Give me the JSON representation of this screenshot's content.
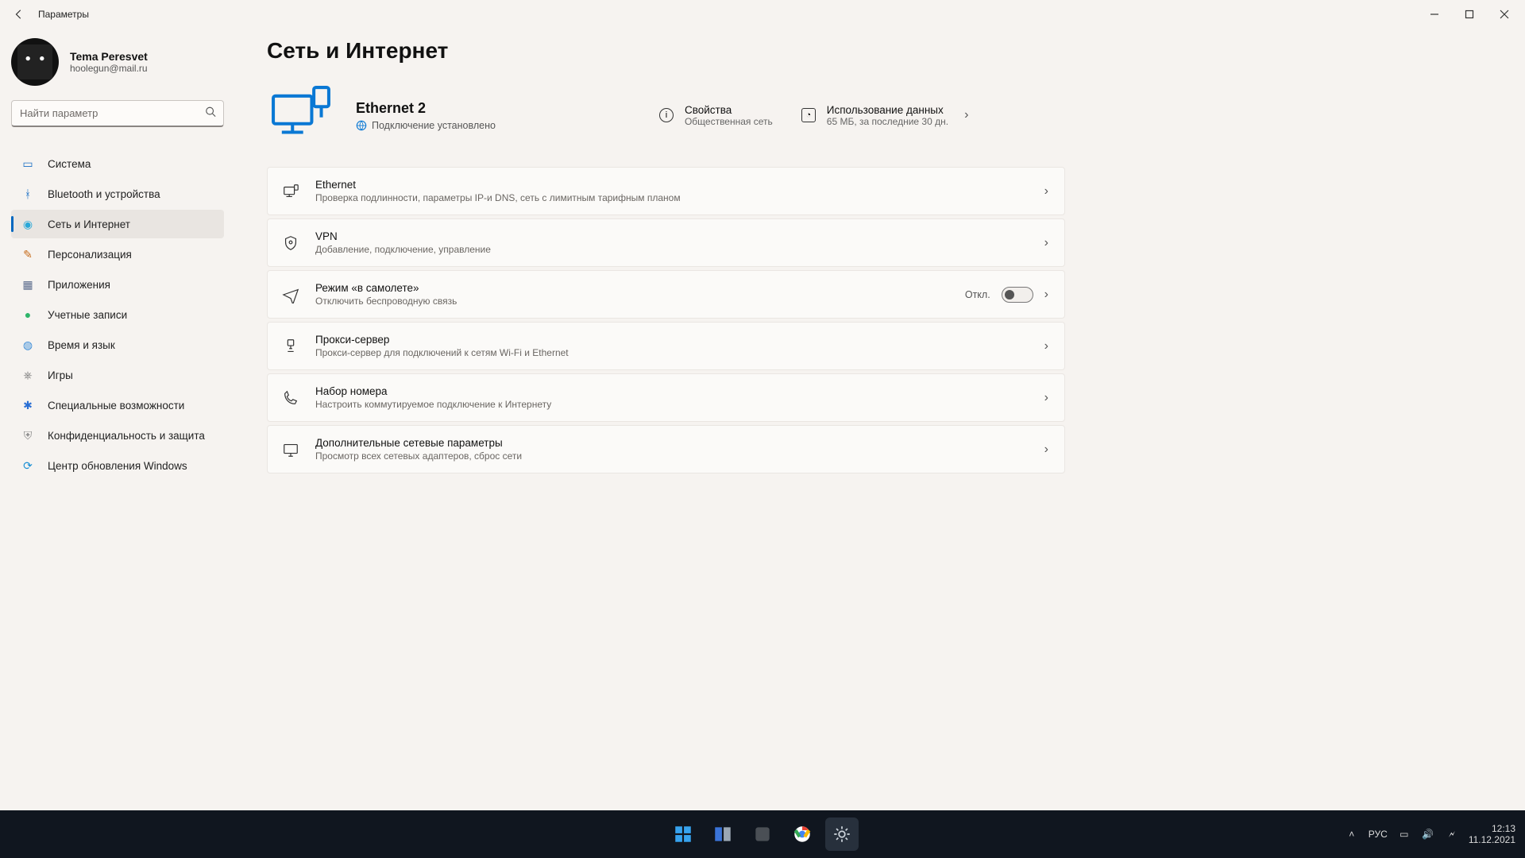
{
  "window": {
    "title": "Параметры"
  },
  "account": {
    "name": "Tema Peresvet",
    "email": "hoolegun@mail.ru"
  },
  "search": {
    "placeholder": "Найти параметр"
  },
  "sidebar": {
    "items": [
      {
        "label": "Система"
      },
      {
        "label": "Bluetooth и устройства"
      },
      {
        "label": "Сеть и Интернет"
      },
      {
        "label": "Персонализация"
      },
      {
        "label": "Приложения"
      },
      {
        "label": "Учетные записи"
      },
      {
        "label": "Время и язык"
      },
      {
        "label": "Игры"
      },
      {
        "label": "Специальные возможности"
      },
      {
        "label": "Конфиденциальность и защита"
      },
      {
        "label": "Центр обновления Windows"
      }
    ],
    "active_index": 2
  },
  "page": {
    "title": "Сеть и Интернет",
    "hero": {
      "connection_name": "Ethernet 2",
      "status": "Подключение установлено",
      "links": {
        "properties": {
          "title": "Свойства",
          "subtitle": "Общественная сеть"
        },
        "data_usage": {
          "title": "Использование данных",
          "subtitle": "65 МБ, за последние 30 дн."
        }
      }
    },
    "rows": {
      "ethernet": {
        "title": "Ethernet",
        "subtitle": "Проверка подлинности, параметры IP-и DNS, сеть с лимитным тарифным планом"
      },
      "vpn": {
        "title": "VPN",
        "subtitle": "Добавление, подключение, управление"
      },
      "airplane": {
        "title": "Режим «в самолете»",
        "subtitle": "Отключить беспроводную связь",
        "toggle_label": "Откл.",
        "toggle_on": false
      },
      "proxy": {
        "title": "Прокси-сервер",
        "subtitle": "Прокси-сервер для подключений к сетям Wi-Fi и Ethernet"
      },
      "dialup": {
        "title": "Набор номера",
        "subtitle": "Настроить коммутируемое подключение к Интернету"
      },
      "advanced": {
        "title": "Дополнительные сетевые параметры",
        "subtitle": "Просмотр всех сетевых адаптеров, сброс сети"
      }
    }
  },
  "taskbar": {
    "lang": "РУС",
    "time": "12:13",
    "date": "11.12.2021"
  }
}
